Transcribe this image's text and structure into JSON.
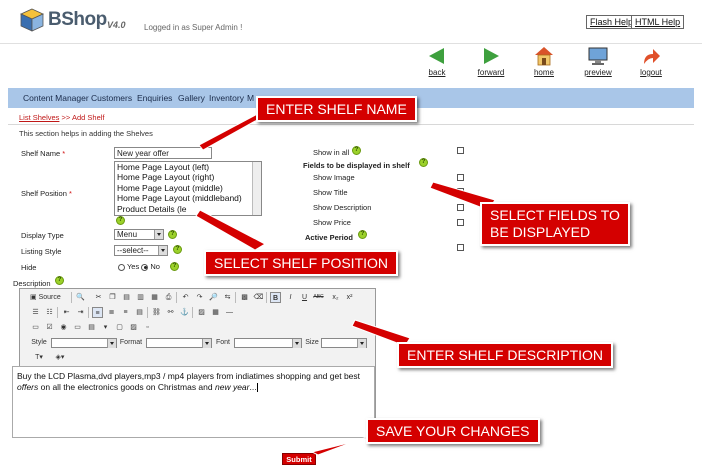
{
  "header": {
    "logo_text": "BShop",
    "version": "V4.0",
    "login_status": "Logged in as Super Admin !",
    "flash_help": "Flash Help",
    "html_help": "HTML Help"
  },
  "nav": {
    "back": "back",
    "forward": "forward",
    "home": "home",
    "preview": "preview",
    "logout": "logout"
  },
  "menu": {
    "items": [
      "Content Manager",
      "Customers",
      "Enquiries",
      "Gallery",
      "Inventory",
      "M"
    ]
  },
  "breadcrumb": {
    "link": "List Shelves",
    "separator": ">>",
    "current": "Add Shelf"
  },
  "help_text": "This section helps in adding the Shelves",
  "form": {
    "shelf_name_label": "Shelf Name",
    "required_mark": "*",
    "shelf_name_value": "New year offer",
    "shelf_position_label": "Shelf Position",
    "shelf_position_options": [
      "Home Page Layout (left)",
      "Home Page Layout (right)",
      "Home Page Layout (middle)",
      "Home Page Layout (middleband)",
      "Product Details (le"
    ],
    "display_type_label": "Display Type",
    "display_type_value": "Menu",
    "listing_style_label": "Listing Style",
    "listing_style_value": "--select--",
    "hide_label": "Hide",
    "hide_yes": "Yes",
    "hide_no": "No",
    "description_label": "Description",
    "show_in_all": "Show in all",
    "fields_heading": "Fields to be displayed in shelf",
    "show_image": "Show Image",
    "show_title": "Show Title",
    "show_description": "Show Description",
    "show_price": "Show Price",
    "active_period": "Active Period",
    "help_glyph": "?"
  },
  "editor": {
    "source_label": "Source",
    "style_label": "Style",
    "format_label": "Format",
    "font_label": "Font",
    "size_label": "Size",
    "content_start": "Buy the LCD Plasma,dvd players,mp3 / mp4 players from indiatimes shopping and get best ",
    "content_em1": "offers",
    "content_mid": " on all the electronics goods on Christmas and ",
    "content_em2": "new year",
    "content_end": "...",
    "submit_label": "Submit"
  },
  "callouts": {
    "shelf_name": "ENTER SHELF NAME",
    "fields": "SELECT FIELDS TO BE DISPLAYED",
    "fields_line1": "SELECT FIELDS TO",
    "fields_line2": "BE DISPLAYED",
    "position": "SELECT SHELF POSITION",
    "description": "ENTER SHELF DESCRIPTION",
    "save": "SAVE YOUR CHANGES"
  },
  "colors": {
    "menu_bar": "#a9c6e8",
    "callout_red": "#d40000",
    "nav_green": "#3ea03e",
    "link_red": "#c01818"
  }
}
